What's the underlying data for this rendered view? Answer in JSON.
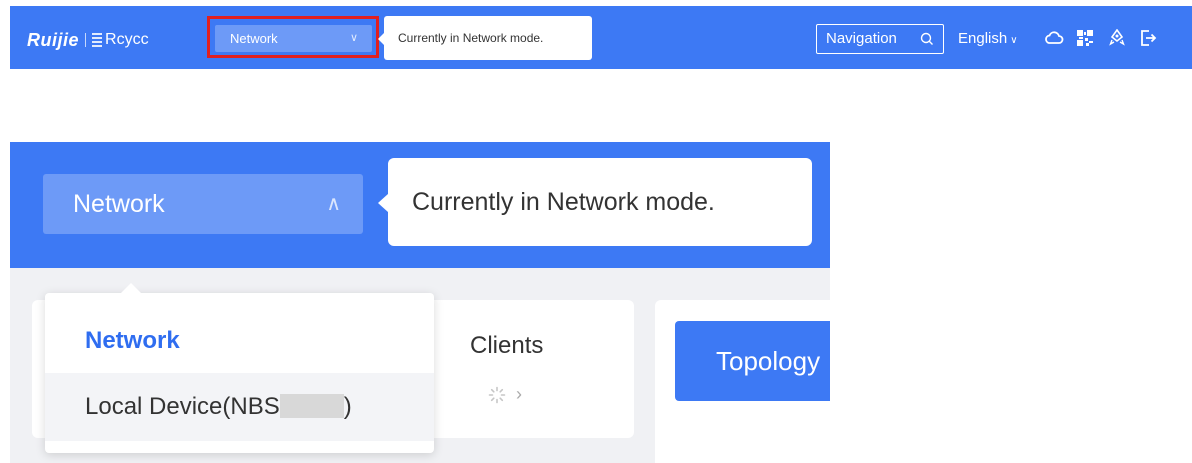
{
  "header": {
    "logo_primary": "Ruijie",
    "logo_secondary": "Rcycc",
    "mode_select_value": "Network",
    "tooltip_text": "Currently in Network mode.",
    "navigation_label": "Navigation",
    "language_label": "English"
  },
  "zoom": {
    "mode_select_value": "Network",
    "tooltip_text": "Currently in Network mode.",
    "dropdown": {
      "options": [
        "Network",
        "Local Device(NBS",
        ")"
      ],
      "selected": "Network"
    },
    "clients_label": "Clients",
    "topology_label": "Topology"
  },
  "colors": {
    "brand_blue": "#3d79f4",
    "select_blue": "#6d9af7",
    "highlight_red": "#e02020",
    "active_text": "#2f6df0"
  },
  "icons": [
    "chevron-down-icon",
    "search-icon",
    "cloud-icon",
    "qr-code-icon",
    "rocket-icon",
    "logout-icon",
    "chevron-up-icon",
    "loading-spinner-icon",
    "chevron-right-icon"
  ]
}
